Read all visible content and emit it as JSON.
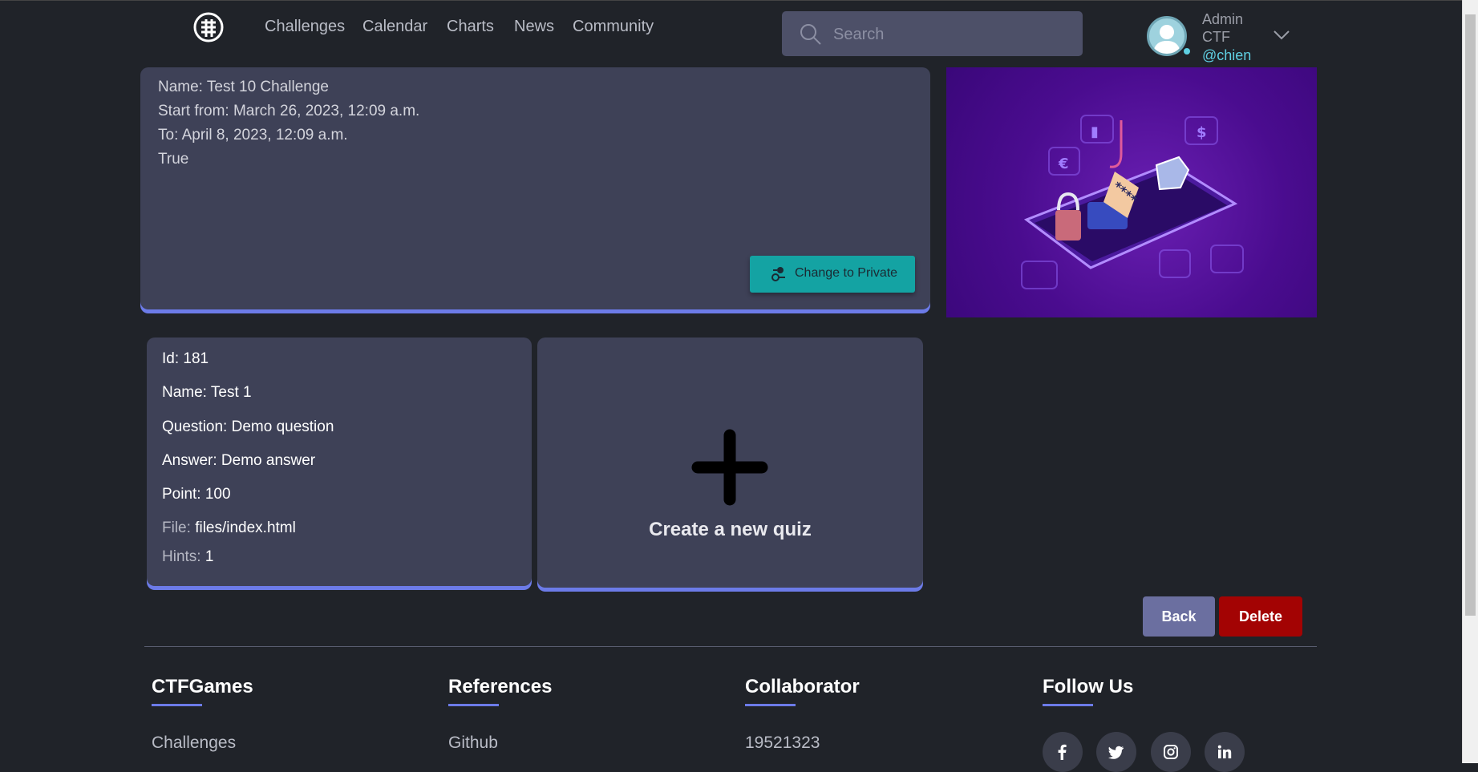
{
  "nav": {
    "items": [
      "Challenges",
      "Calendar",
      "Charts",
      "News",
      "Community"
    ]
  },
  "search": {
    "placeholder": "Search"
  },
  "user": {
    "name": "Admin CTF",
    "handle": "@chien"
  },
  "challenge": {
    "name": "Name: Test 10 Challenge",
    "start": "Start from: March 26, 2023, 12:09 a.m.",
    "end": "To: April 8, 2023, 12:09 a.m.",
    "public": "True",
    "toggle_label": "Change to Private"
  },
  "quiz": {
    "id": "Id: 181",
    "name": "Name: Test 1",
    "question": "Question: Demo question",
    "answer": "Answer: Demo answer",
    "point": "Point: 100",
    "file_key": "File:",
    "file_val": "files/index.html",
    "hints_key": "Hints:",
    "hints_val": "1"
  },
  "new_quiz": {
    "label": "Create a new quiz"
  },
  "actions": {
    "back": "Back",
    "delete": "Delete"
  },
  "footer": {
    "col1": {
      "title": "CTFGames",
      "link": "Challenges"
    },
    "col2": {
      "title": "References",
      "link": "Github"
    },
    "col3": {
      "title": "Collaborator",
      "link": "19521323"
    },
    "col4": {
      "title": "Follow Us",
      "icons": [
        "facebook-icon",
        "twitter-icon",
        "instagram-icon",
        "linkedin-icon"
      ]
    }
  },
  "colors": {
    "background": "#202329",
    "card": "#3e4157",
    "accent": "#6c7be8",
    "teal_button": "#14a3a3",
    "delete": "#a30303",
    "back": "#6b6fa0"
  }
}
